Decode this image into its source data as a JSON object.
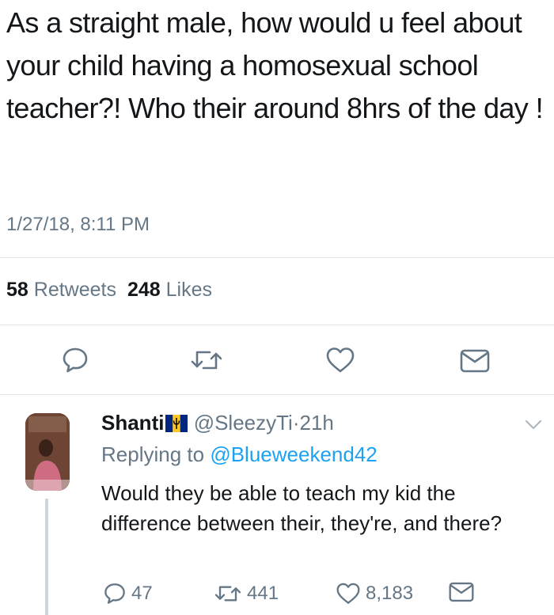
{
  "tweet": {
    "text": "As a straight male, how would u feel about your child having a homosexual school teacher?! Who their around 8hrs of the day !",
    "timestamp": "1/27/18, 8:11 PM",
    "retweet_count": "58",
    "retweet_label": "Retweets",
    "like_count": "248",
    "like_label": "Likes"
  },
  "actions": [
    "reply-icon",
    "retweet-icon",
    "like-icon",
    "direct-message-icon"
  ],
  "reply": {
    "name": "Shanti",
    "flag_icon": "barbados-flag-icon",
    "handle": "@SleezyTi",
    "separator": "·",
    "age": "21h",
    "replying_prefix": "Replying to",
    "replying_to": "@Blueweekend42",
    "text": "Would they be able to teach my kid the difference between their, they're, and there?",
    "reply_count": "47",
    "retweet_count": "441",
    "like_count": "8,183"
  },
  "colors": {
    "text": "#14171a",
    "secondary": "#657786",
    "link": "#1da1f2",
    "divider": "#e1e8ed",
    "flag_blue": "#00267f",
    "flag_gold": "#ffc726"
  }
}
